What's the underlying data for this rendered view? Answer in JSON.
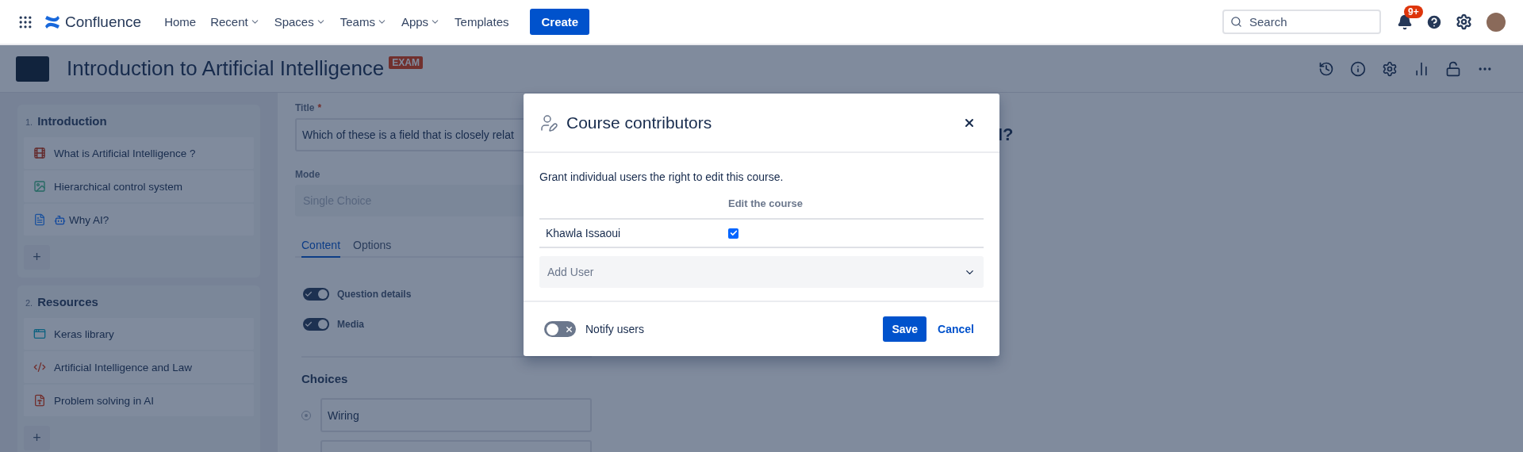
{
  "top_nav": {
    "product": "Confluence",
    "items": [
      {
        "label": "Home",
        "dropdown": false
      },
      {
        "label": "Recent",
        "dropdown": true
      },
      {
        "label": "Spaces",
        "dropdown": true
      },
      {
        "label": "Teams",
        "dropdown": true
      },
      {
        "label": "Apps",
        "dropdown": true
      },
      {
        "label": "Templates",
        "dropdown": false
      }
    ],
    "create": "Create",
    "search": {
      "placeholder": "Search"
    },
    "notification_badge": "9+"
  },
  "page_header": {
    "title": "Introduction to Artificial Intelligence",
    "badge": "EXAM"
  },
  "sidebar": {
    "sections": [
      {
        "number": "1.",
        "title": "Introduction",
        "add": "+",
        "items": [
          {
            "kind": "video",
            "label": "What is Artificial Intelligence ?"
          },
          {
            "kind": "image",
            "label": "Hierarchical control system"
          },
          {
            "kind": "page",
            "label": "Why AI?",
            "robot": true
          }
        ]
      },
      {
        "number": "2.",
        "title": "Resources",
        "add": "+",
        "items": [
          {
            "kind": "web",
            "label": "Keras library"
          },
          {
            "kind": "code",
            "label": "Artificial Intelligence and Law"
          },
          {
            "kind": "pdf",
            "label": "Problem solving in AI"
          }
        ]
      }
    ]
  },
  "form": {
    "title_label": "Title",
    "required_mark": "*",
    "title_value": "Which of these is a field that is closely relat",
    "mode_label": "Mode",
    "mode_value": "Single Choice",
    "mode_disabled": true,
    "tabs": [
      {
        "label": "Content",
        "selected": true
      },
      {
        "label": "Options",
        "selected": false
      }
    ],
    "toggles": [
      {
        "label": "Question details",
        "on": true
      },
      {
        "label": "Media",
        "on": true
      }
    ],
    "choices_heading": "Choices",
    "choices": [
      {
        "value": "Wiring",
        "selected": false
      }
    ]
  },
  "question_heading_tail": "I?",
  "modal": {
    "title": "Course contributors",
    "description": "Grant individual users the right to edit this course.",
    "column_header": "Edit the course",
    "users": [
      {
        "name": "Khawla Issaoui",
        "checked": true
      }
    ],
    "add_user": {
      "placeholder": "Add User"
    },
    "notify": {
      "label": "Notify users",
      "on": false
    },
    "save": "Save",
    "cancel": "Cancel"
  }
}
